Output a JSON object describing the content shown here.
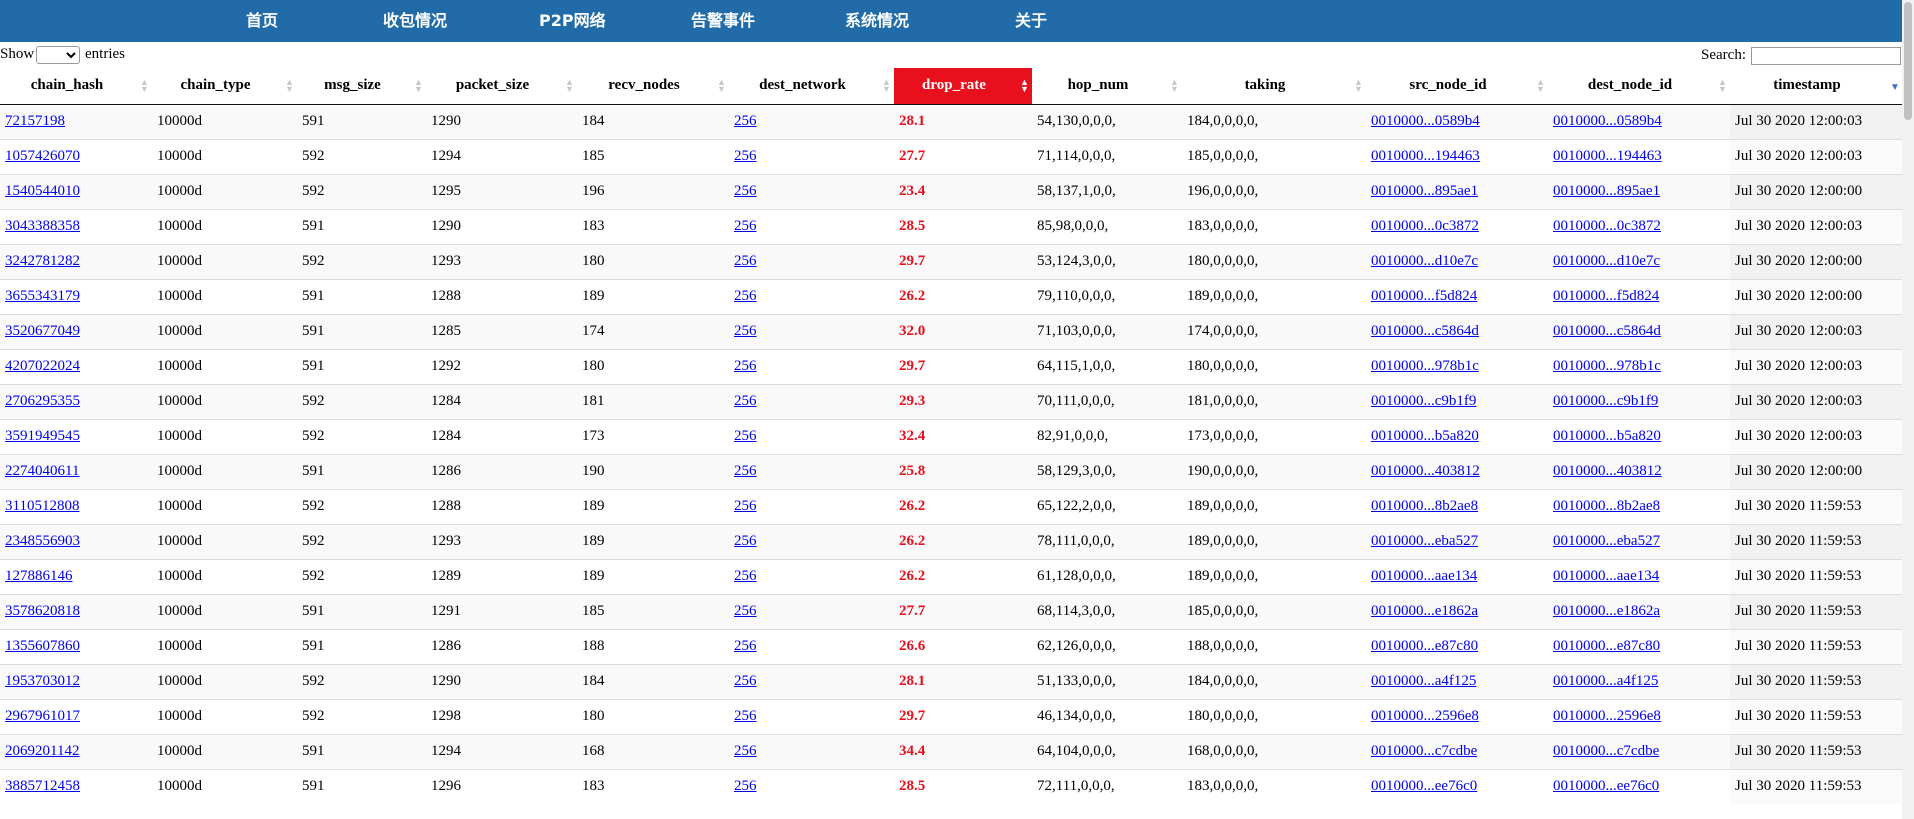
{
  "nav": {
    "items": [
      "首页",
      "收包情况",
      "P2P网络",
      "告警事件",
      "系统情况",
      "关于"
    ]
  },
  "controls": {
    "show_label": "Show",
    "entries_label": "entries",
    "length_value": "",
    "search_label": "Search:",
    "search_value": ""
  },
  "table": {
    "columns": [
      "chain_hash",
      "chain_type",
      "msg_size",
      "packet_size",
      "recv_nodes",
      "dest_network",
      "drop_rate",
      "hop_num",
      "taking",
      "src_node_id",
      "dest_node_id",
      "timestamp"
    ],
    "sorted_column": "drop_rate",
    "rows": [
      [
        "72157198",
        "10000d",
        "591",
        "1290",
        "184",
        "256",
        "28.1",
        "54,130,0,0,0,",
        "184,0,0,0,0,",
        "0010000...0589b4",
        "0010000...0589b4",
        "Jul 30 2020 12:00:03"
      ],
      [
        "1057426070",
        "10000d",
        "592",
        "1294",
        "185",
        "256",
        "27.7",
        "71,114,0,0,0,",
        "185,0,0,0,0,",
        "0010000...194463",
        "0010000...194463",
        "Jul 30 2020 12:00:03"
      ],
      [
        "1540544010",
        "10000d",
        "592",
        "1295",
        "196",
        "256",
        "23.4",
        "58,137,1,0,0,",
        "196,0,0,0,0,",
        "0010000...895ae1",
        "0010000...895ae1",
        "Jul 30 2020 12:00:00"
      ],
      [
        "3043388358",
        "10000d",
        "591",
        "1290",
        "183",
        "256",
        "28.5",
        "85,98,0,0,0,",
        "183,0,0,0,0,",
        "0010000...0c3872",
        "0010000...0c3872",
        "Jul 30 2020 12:00:03"
      ],
      [
        "3242781282",
        "10000d",
        "592",
        "1293",
        "180",
        "256",
        "29.7",
        "53,124,3,0,0,",
        "180,0,0,0,0,",
        "0010000...d10e7c",
        "0010000...d10e7c",
        "Jul 30 2020 12:00:00"
      ],
      [
        "3655343179",
        "10000d",
        "591",
        "1288",
        "189",
        "256",
        "26.2",
        "79,110,0,0,0,",
        "189,0,0,0,0,",
        "0010000...f5d824",
        "0010000...f5d824",
        "Jul 30 2020 12:00:00"
      ],
      [
        "3520677049",
        "10000d",
        "591",
        "1285",
        "174",
        "256",
        "32.0",
        "71,103,0,0,0,",
        "174,0,0,0,0,",
        "0010000...c5864d",
        "0010000...c5864d",
        "Jul 30 2020 12:00:03"
      ],
      [
        "4207022024",
        "10000d",
        "591",
        "1292",
        "180",
        "256",
        "29.7",
        "64,115,1,0,0,",
        "180,0,0,0,0,",
        "0010000...978b1c",
        "0010000...978b1c",
        "Jul 30 2020 12:00:03"
      ],
      [
        "2706295355",
        "10000d",
        "592",
        "1284",
        "181",
        "256",
        "29.3",
        "70,111,0,0,0,",
        "181,0,0,0,0,",
        "0010000...c9b1f9",
        "0010000...c9b1f9",
        "Jul 30 2020 12:00:03"
      ],
      [
        "3591949545",
        "10000d",
        "592",
        "1284",
        "173",
        "256",
        "32.4",
        "82,91,0,0,0,",
        "173,0,0,0,0,",
        "0010000...b5a820",
        "0010000...b5a820",
        "Jul 30 2020 12:00:03"
      ],
      [
        "2274040611",
        "10000d",
        "591",
        "1286",
        "190",
        "256",
        "25.8",
        "58,129,3,0,0,",
        "190,0,0,0,0,",
        "0010000...403812",
        "0010000...403812",
        "Jul 30 2020 12:00:00"
      ],
      [
        "3110512808",
        "10000d",
        "592",
        "1288",
        "189",
        "256",
        "26.2",
        "65,122,2,0,0,",
        "189,0,0,0,0,",
        "0010000...8b2ae8",
        "0010000...8b2ae8",
        "Jul 30 2020 11:59:53"
      ],
      [
        "2348556903",
        "10000d",
        "592",
        "1293",
        "189",
        "256",
        "26.2",
        "78,111,0,0,0,",
        "189,0,0,0,0,",
        "0010000...eba527",
        "0010000...eba527",
        "Jul 30 2020 11:59:53"
      ],
      [
        "127886146",
        "10000d",
        "592",
        "1289",
        "189",
        "256",
        "26.2",
        "61,128,0,0,0,",
        "189,0,0,0,0,",
        "0010000...aae134",
        "0010000...aae134",
        "Jul 30 2020 11:59:53"
      ],
      [
        "3578620818",
        "10000d",
        "591",
        "1291",
        "185",
        "256",
        "27.7",
        "68,114,3,0,0,",
        "185,0,0,0,0,",
        "0010000...e1862a",
        "0010000...e1862a",
        "Jul 30 2020 11:59:53"
      ],
      [
        "1355607860",
        "10000d",
        "591",
        "1286",
        "188",
        "256",
        "26.6",
        "62,126,0,0,0,",
        "188,0,0,0,0,",
        "0010000...e87c80",
        "0010000...e87c80",
        "Jul 30 2020 11:59:53"
      ],
      [
        "1953703012",
        "10000d",
        "592",
        "1290",
        "184",
        "256",
        "28.1",
        "51,133,0,0,0,",
        "184,0,0,0,0,",
        "0010000...a4f125",
        "0010000...a4f125",
        "Jul 30 2020 11:59:53"
      ],
      [
        "2967961017",
        "10000d",
        "592",
        "1298",
        "180",
        "256",
        "29.7",
        "46,134,0,0,0,",
        "180,0,0,0,0,",
        "0010000...2596e8",
        "0010000...2596e8",
        "Jul 30 2020 11:59:53"
      ],
      [
        "2069201142",
        "10000d",
        "591",
        "1294",
        "168",
        "256",
        "34.4",
        "64,104,0,0,0,",
        "168,0,0,0,0,",
        "0010000...c7cdbe",
        "0010000...c7cdbe",
        "Jul 30 2020 11:59:53"
      ],
      [
        "3885712458",
        "10000d",
        "591",
        "1296",
        "183",
        "256",
        "28.5",
        "72,111,0,0,0,",
        "183,0,0,0,0,",
        "0010000...ee76c0",
        "0010000...ee76c0",
        "Jul 30 2020 11:59:53"
      ]
    ]
  },
  "colors": {
    "nav_bg": "#206ba8",
    "sorted_header_bg": "#e8101d",
    "drop_rate_text": "#e8101d",
    "link": "#0000ee"
  }
}
